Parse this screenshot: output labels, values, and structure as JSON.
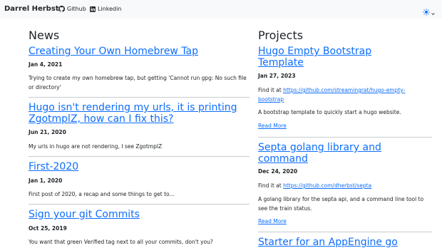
{
  "navbar": {
    "brand": "Darrel Herbst",
    "github_label": "Github",
    "linkedin_label": "Linkedin"
  },
  "news": {
    "title": "News",
    "posts": [
      {
        "title": "Creating Your Own Homebrew Tap",
        "date": "Jan 4, 2021",
        "summary": "Trying to create my own homebrew tap, but getting 'Cannot run gpg: No such file or directory'"
      },
      {
        "title": "Hugo isn't rendering my urls, it is printing ZgotmplZ, how can I fix this?",
        "date": "Jun 21, 2020",
        "summary": "My urls in hugo are not rendering, I see ZgotmplZ"
      },
      {
        "title": "First-2020",
        "date": "Jan 1, 2020",
        "summary": "First post of 2020, a recap and some things to get to..."
      },
      {
        "title": "Sign your git Commits",
        "date": "Oct 25, 2019",
        "summary": "You want that green Verified tag next to all your commits, don't you?"
      }
    ]
  },
  "projects": {
    "title": "Projects",
    "items": [
      {
        "title": "Hugo Empty Bootstrap Template",
        "date": "Jan 27, 2023",
        "find_prefix": "Find it at ",
        "link": "https://github.com/streamingrat/hugo-empty-bootstrap",
        "desc": "A bootstrap template to quickly start a hugo website.",
        "more": "Read More"
      },
      {
        "title": "Septa golang library and command",
        "date": "Dec 24, 2020",
        "find_prefix": "Find it at ",
        "link": "https://github.com/dherbst/septa",
        "desc": "A golang library for the septa api, and a command line tool to see the train status.",
        "more": "Read More"
      },
      {
        "title": "Starter for an AppEngine go"
      }
    ]
  },
  "colors": {
    "link": "#0d6efd",
    "text": "#212529",
    "navbar_bg": "#f8f9fa",
    "divider": "#c8cbce"
  },
  "icons": {
    "github": "github-icon",
    "linkedin": "linkedin-icon",
    "theme": "sun-icon"
  }
}
